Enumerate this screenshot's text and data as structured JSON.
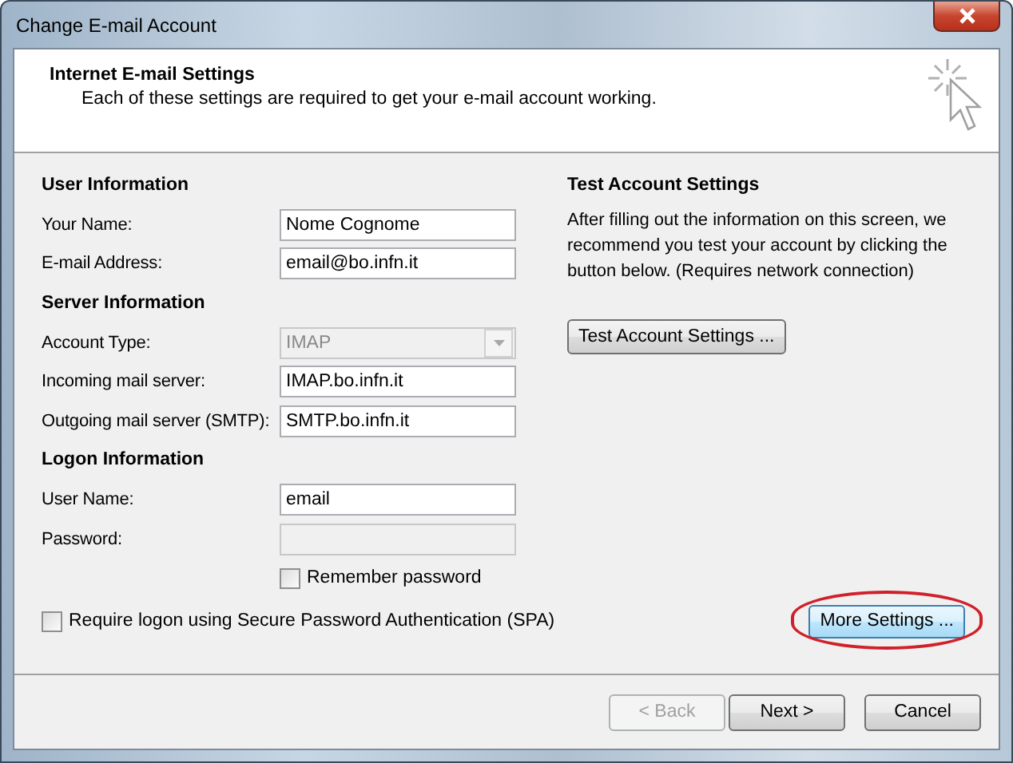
{
  "window": {
    "title": "Change E-mail Account"
  },
  "header": {
    "title": "Internet E-mail Settings",
    "subtitle": "Each of these settings are required to get your e-mail account working."
  },
  "sections": [
    {
      "title": "User Information",
      "fields": [
        {
          "kind": "text",
          "label": "Your Name:",
          "value": "Nome Cognome",
          "disabled": false
        },
        {
          "kind": "text",
          "label": "E-mail Address:",
          "value": "email@bo.infn.it",
          "disabled": false
        }
      ]
    },
    {
      "title": "Server Information",
      "fields": [
        {
          "kind": "dropdown",
          "label": "Account Type:",
          "value": "IMAP",
          "disabled": true
        },
        {
          "kind": "text",
          "label": "Incoming mail server:",
          "value": "IMAP.bo.infn.it",
          "disabled": false
        },
        {
          "kind": "text",
          "label": "Outgoing mail server (SMTP):",
          "value": "SMTP.bo.infn.it",
          "disabled": false
        }
      ]
    },
    {
      "title": "Logon Information",
      "fields": [
        {
          "kind": "text",
          "label": "User Name:",
          "value": "email",
          "disabled": false
        },
        {
          "kind": "text",
          "label": "Password:",
          "disabled": true
        },
        {
          "kind": "checkbox",
          "label": "Remember password",
          "checked": false
        }
      ]
    }
  ],
  "spa_option": {
    "label": "Require logon using Secure Password Authentication (SPA)",
    "checked": false
  },
  "test_panel": {
    "title": "Test Account Settings",
    "description": "After filling out the information on this screen, we recommend you test your account by clicking the button below. (Requires network connection)",
    "button": "Test Account Settings ..."
  },
  "more_settings": {
    "label": "More Settings ...",
    "highlighted": true
  },
  "buttons": [
    {
      "label": "< Back",
      "disabled": true
    },
    {
      "label": "Next >",
      "disabled": false
    },
    {
      "label": "Cancel",
      "disabled": false
    }
  ]
}
